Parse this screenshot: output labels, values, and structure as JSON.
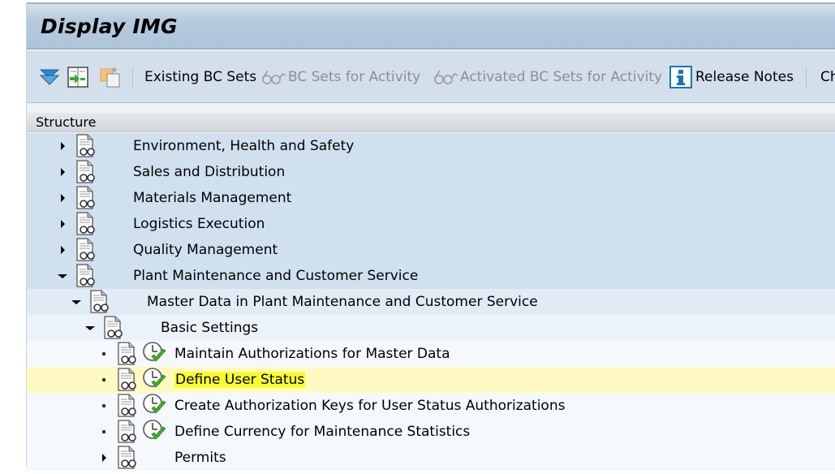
{
  "window": {
    "title": "Display IMG"
  },
  "toolbar": {
    "icons": [
      "expand-all-icon",
      "import-icon",
      "copy-paste-icon"
    ],
    "items": [
      {
        "label": "Existing BC Sets",
        "icon": null,
        "enabled": true
      },
      {
        "label": "BC Sets for Activity",
        "icon": "glasses-icon",
        "enabled": false
      },
      {
        "label": "Activated BC Sets for Activity",
        "icon": "glasses-icon",
        "enabled": false
      },
      {
        "label": "Release Notes",
        "icon": "info-icon",
        "enabled": true
      },
      {
        "label": "Ch",
        "icon": null,
        "enabled": true
      }
    ]
  },
  "structure": {
    "header": "Structure",
    "nodes": [
      {
        "label": "Environment, Health and Safety",
        "level": 0,
        "state": "collapsed"
      },
      {
        "label": "Sales and Distribution",
        "level": 0,
        "state": "collapsed"
      },
      {
        "label": "Materials Management",
        "level": 0,
        "state": "collapsed"
      },
      {
        "label": "Logistics Execution",
        "level": 0,
        "state": "collapsed"
      },
      {
        "label": "Quality Management",
        "level": 0,
        "state": "collapsed"
      },
      {
        "label": "Plant Maintenance and Customer Service",
        "level": 0,
        "state": "expanded"
      },
      {
        "label": "Master Data in Plant Maintenance and Customer Service",
        "level": 1,
        "state": "expanded"
      },
      {
        "label": "Basic Settings",
        "level": 2,
        "state": "expanded"
      },
      {
        "label": "Maintain Authorizations for Master Data",
        "level": 3,
        "state": "leaf",
        "activity": true
      },
      {
        "label": "Define User Status",
        "level": 3,
        "state": "leaf",
        "activity": true,
        "selected": true
      },
      {
        "label": "Create Authorization Keys for User Status Authorizations",
        "level": 3,
        "state": "leaf",
        "activity": true
      },
      {
        "label": "Define Currency for Maintenance Statistics",
        "level": 3,
        "state": "leaf",
        "activity": true
      },
      {
        "label": "Permits",
        "level": 3,
        "state": "collapsed"
      }
    ]
  },
  "colors": {
    "title_gradient_top": "#d4e1ec",
    "title_gradient_bottom": "#aec5da",
    "toolbar_bg": "#d3dfeb",
    "level0_bg": "#d1e0ee",
    "level1_bg": "#e0ebf6",
    "level2_bg": "#ebf2fa",
    "level3_bg": "#f5f8fd",
    "selected_row_bg": "#fffac1",
    "text_highlight": "#fbfb2d",
    "info_icon_blue": "#1a73c0",
    "check_green": "#3fae2a"
  }
}
